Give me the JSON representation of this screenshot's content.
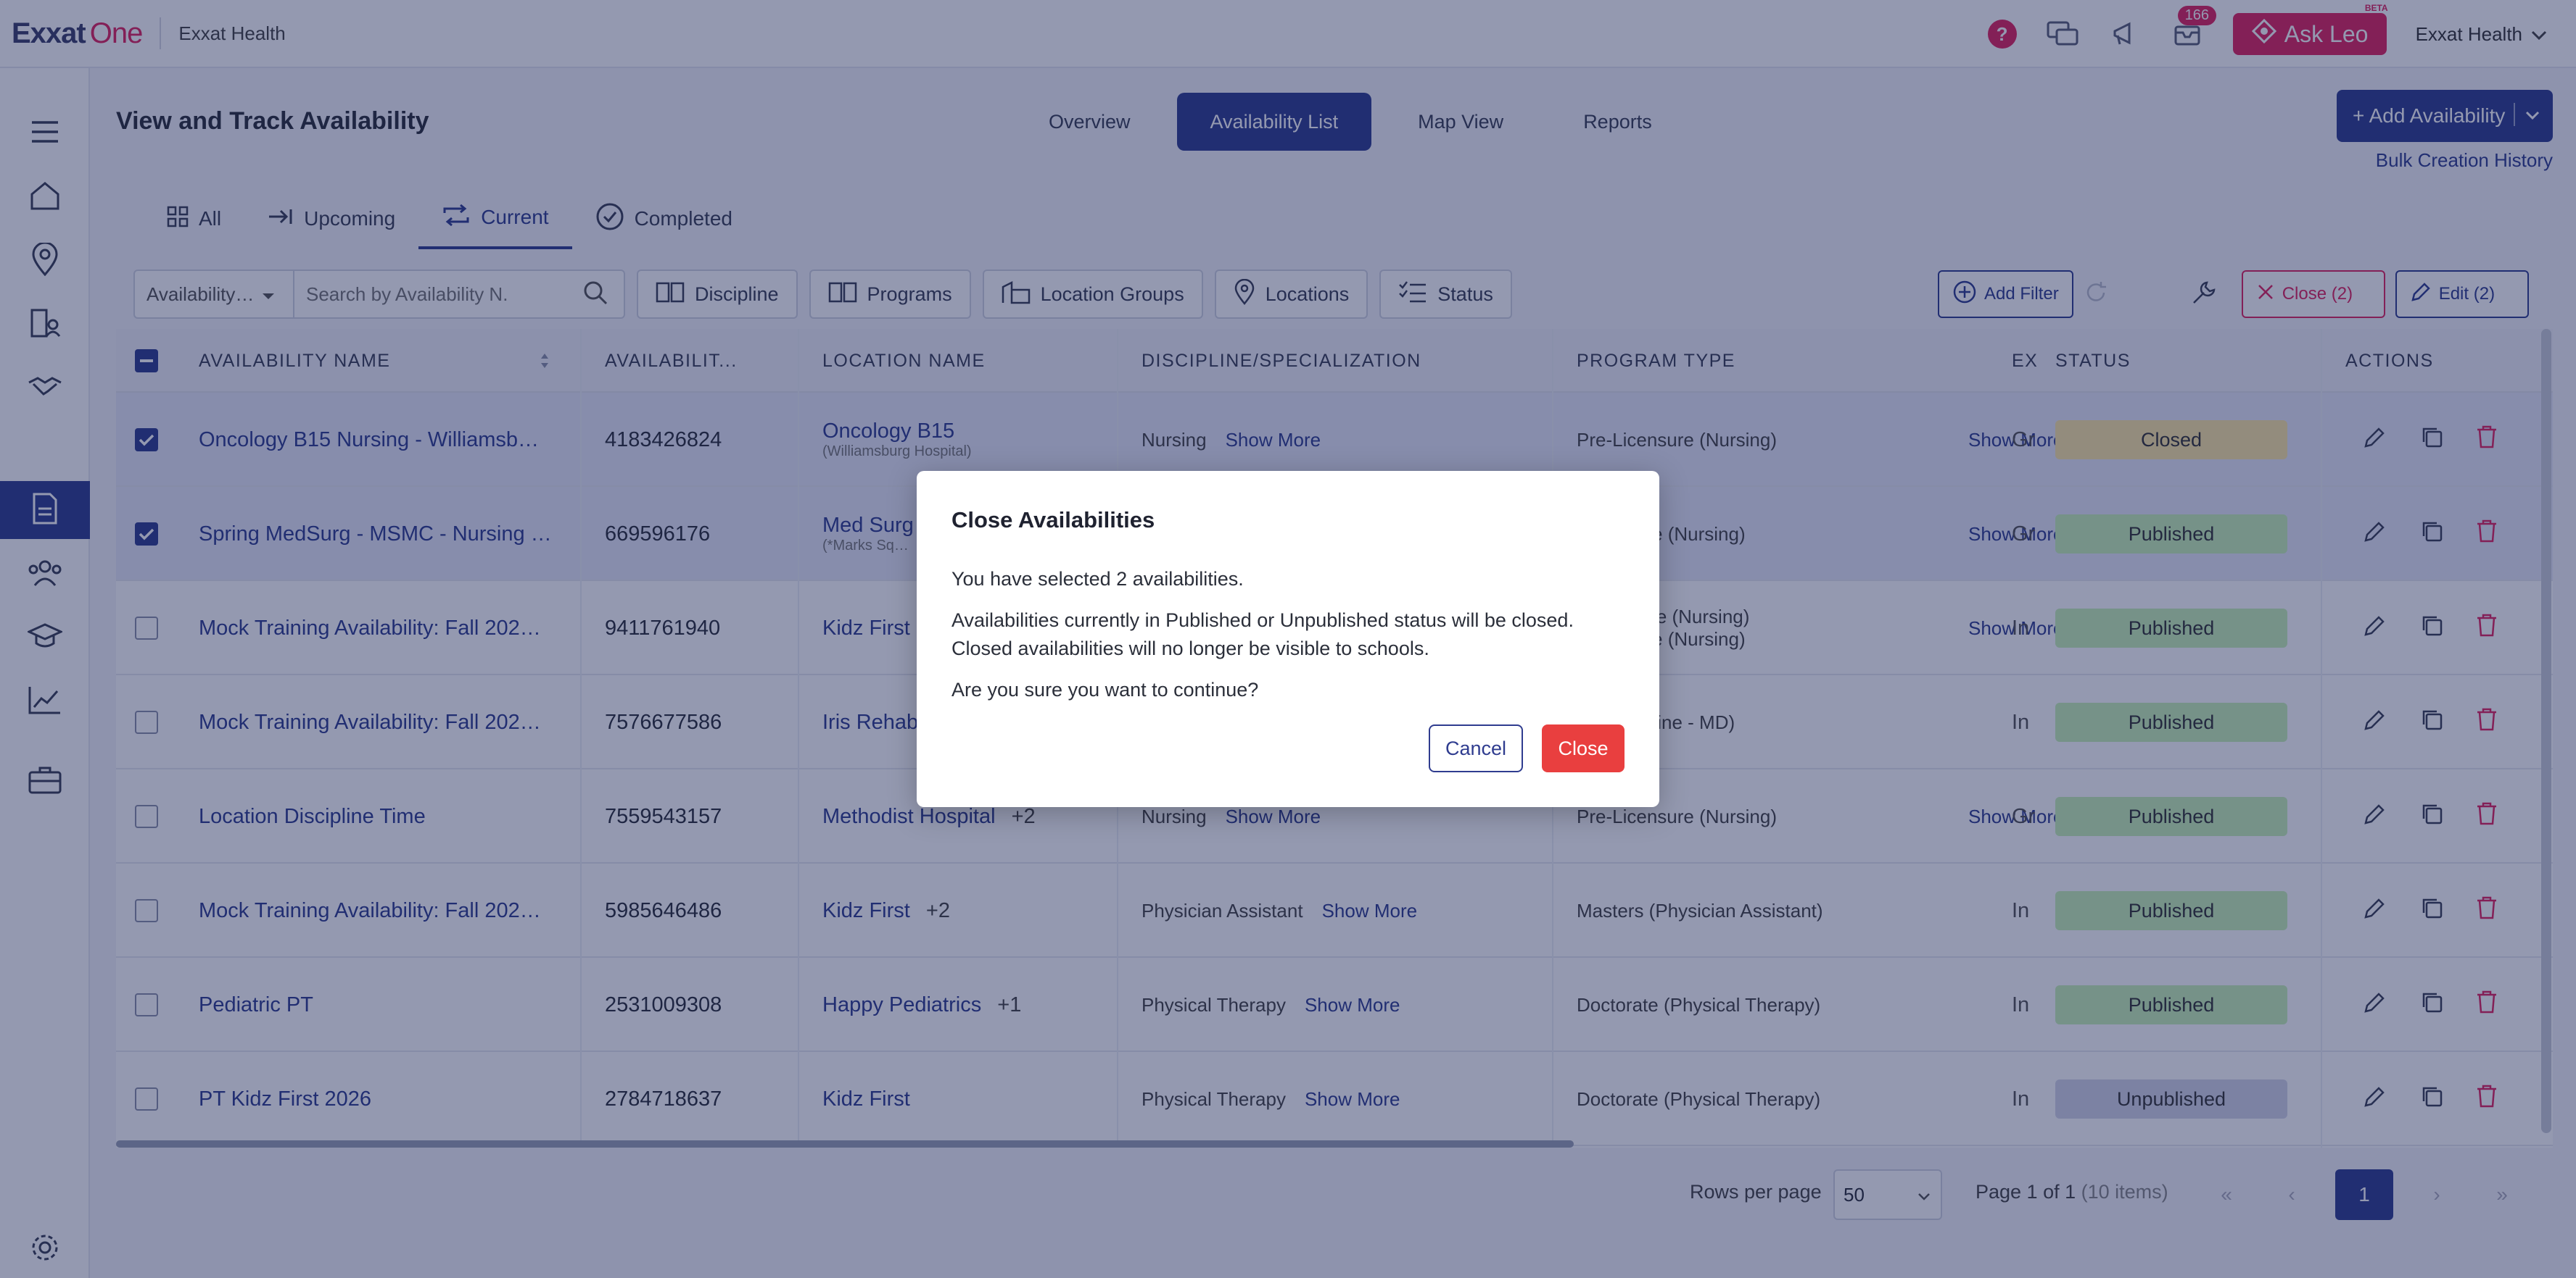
{
  "brand": {
    "logo_text": "Exxat",
    "logo_one": "One",
    "org": "Exxat Health"
  },
  "topbar": {
    "help": "?",
    "notifications_count": "166",
    "ask_leo": "Ask Leo",
    "ask_leo_badge": "BETA",
    "org_switch": "Exxat Health"
  },
  "page": {
    "title": "View and Track Availability"
  },
  "view_tabs": [
    "Overview",
    "Availability List",
    "Map View",
    "Reports"
  ],
  "actions": {
    "add_availability": "+ Add Availability",
    "bulk_history": "Bulk Creation History"
  },
  "sub_tabs": [
    "All",
    "Upcoming",
    "Current",
    "Completed"
  ],
  "filters": {
    "search_select": "Availability…",
    "search_placeholder": "Search by Availability N.",
    "chips": [
      "Discipline",
      "Programs",
      "Location Groups",
      "Locations",
      "Status"
    ],
    "add_filter": "Add Filter",
    "close_selected": "Close (2)",
    "edit_selected": "Edit (2)"
  },
  "table": {
    "headers": [
      "Availability Name",
      "Availabilit...",
      "Location Name",
      "Discipline/Specialization",
      "Program Type",
      "Ex",
      "Status",
      "Actions"
    ],
    "show_more": "Show More",
    "rows": [
      {
        "name": "Oncology B15 Nursing - Williamsb…",
        "id": "4183426824",
        "location": "Oncology B15",
        "location_sub": "(Williamsburg Hospital)",
        "location_extra": "",
        "discipline": "Nursing",
        "program": "Pre-Licensure (Nursing)",
        "program2": "",
        "ex": "Gr",
        "status": "Closed",
        "checked": true
      },
      {
        "name": "Spring MedSurg - MSMC - Nursing …",
        "id": "669596176",
        "location": "Med Surg",
        "location_sub": "(*Marks Sq…",
        "location_extra": "",
        "discipline": "",
        "program": "…censure (Nursing)",
        "program2": "",
        "ex": "Gr",
        "status": "Published",
        "checked": true
      },
      {
        "name": "Mock Training Availability: Fall 202…",
        "id": "9411761940",
        "location": "Kidz First",
        "location_sub": "",
        "location_extra": "",
        "discipline": "",
        "program": "…icensure (Nursing)",
        "program2": "…censure (Nursing)",
        "ex": "In",
        "status": "Published",
        "checked": false
      },
      {
        "name": "Mock Training Availability: Fall 202…",
        "id": "7576677586",
        "location": "Iris Rehab",
        "location_sub": "",
        "location_extra": "",
        "discipline": "",
        "program": "… (Medicine - MD)",
        "program2": "",
        "ex": "In",
        "status": "Published",
        "checked": false
      },
      {
        "name": "Location Discipline Time",
        "id": "7559543157",
        "location": "Methodist Hospital",
        "location_sub": "",
        "location_extra": "+2",
        "discipline": "Nursing",
        "program": "Pre-Licensure (Nursing)",
        "program2": "",
        "ex": "Gr",
        "status": "Published",
        "checked": false
      },
      {
        "name": "Mock Training Availability: Fall 202…",
        "id": "5985646486",
        "location": "Kidz First",
        "location_sub": "",
        "location_extra": "+2",
        "discipline": "Physician Assistant",
        "program": "Masters (Physician Assistant)",
        "program2": "",
        "ex": "In",
        "status": "Published",
        "checked": false
      },
      {
        "name": "Pediatric PT",
        "id": "2531009308",
        "location": "Happy Pediatrics",
        "location_sub": "",
        "location_extra": "+1",
        "discipline": "Physical Therapy",
        "program": "Doctorate (Physical Therapy)",
        "program2": "",
        "ex": "In",
        "status": "Published",
        "checked": false
      },
      {
        "name": "PT Kidz First 2026",
        "id": "2784718637",
        "location": "Kidz First",
        "location_sub": "",
        "location_extra": "",
        "discipline": "Physical Therapy",
        "program": "Doctorate (Physical Therapy)",
        "program2": "",
        "ex": "In",
        "status": "Unpublished",
        "checked": false
      }
    ]
  },
  "pagination": {
    "rows_per_page_label": "Rows per page",
    "rows_per_page": "50",
    "page_info": "Page 1 of 1",
    "items": "(10 items)",
    "current": "1"
  },
  "modal": {
    "title": "Close Availabilities",
    "line1": "You have selected 2 availabilities.",
    "line2": "Availabilities currently in Published or Unpublished status will be closed.",
    "line3": "Closed availabilities will no longer be visible to schools.",
    "line4": "Are you sure you want to continue?",
    "cancel": "Cancel",
    "close": "Close"
  },
  "colors": {
    "primary": "#2f3c8f",
    "accent": "#e0245e",
    "danger": "#e93f3f",
    "closed": "#fde8a3",
    "published": "#c8f2b6",
    "unpublished": "#d3d6e8"
  }
}
